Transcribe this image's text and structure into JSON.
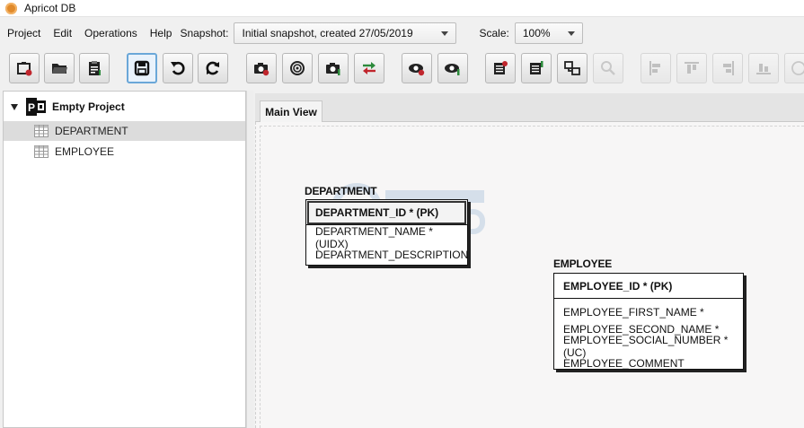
{
  "window": {
    "title": "Apricot DB"
  },
  "menu": {
    "items": [
      "Project",
      "Edit",
      "Operations",
      "Help"
    ],
    "snapshot_label": "Snapshot:",
    "snapshot_value": "Initial snapshot, created 27/05/2019",
    "scale_label": "Scale:",
    "scale_value": "100%"
  },
  "toolbar": {
    "buttons": [
      {
        "icon": "new-project-icon",
        "state": "normal"
      },
      {
        "icon": "open-folder-icon",
        "state": "normal"
      },
      {
        "icon": "clipboard-icon",
        "state": "normal"
      },
      {
        "icon": "save-icon",
        "state": "active"
      },
      {
        "icon": "undo-icon",
        "state": "normal"
      },
      {
        "icon": "redo-icon",
        "state": "normal"
      },
      {
        "icon": "snapshot-new-icon",
        "state": "normal"
      },
      {
        "icon": "snapshot-view-icon",
        "state": "normal"
      },
      {
        "icon": "snapshot-edit-icon",
        "state": "normal"
      },
      {
        "icon": "compare-icon",
        "state": "normal"
      },
      {
        "icon": "view-add-icon",
        "state": "normal"
      },
      {
        "icon": "view-edit-icon",
        "state": "normal"
      },
      {
        "icon": "table-add-icon",
        "state": "normal"
      },
      {
        "icon": "table-edit-icon",
        "state": "normal"
      },
      {
        "icon": "relationship-icon",
        "state": "normal"
      },
      {
        "icon": "search-icon",
        "state": "disabled"
      },
      {
        "icon": "align-left-icon",
        "state": "disabled"
      },
      {
        "icon": "align-top-icon",
        "state": "disabled"
      },
      {
        "icon": "align-right-icon",
        "state": "disabled"
      },
      {
        "icon": "align-bottom-icon",
        "state": "disabled"
      },
      {
        "icon": "more-icon",
        "state": "disabled"
      }
    ]
  },
  "sidebar": {
    "project_name": "Empty Project",
    "tables": [
      {
        "name": "DEPARTMENT",
        "selected": true
      },
      {
        "name": "EMPLOYEE",
        "selected": false
      }
    ]
  },
  "main": {
    "tab_label": "Main View",
    "entities": [
      {
        "name": "DEPARTMENT",
        "pk": "DEPARTMENT_ID * (PK)",
        "columns": [
          "DEPARTMENT_NAME * (UIDX)",
          "DEPARTMENT_DESCRIPTION"
        ]
      },
      {
        "name": "EMPLOYEE",
        "pk": "EMPLOYEE_ID * (PK)",
        "columns": [
          "EMPLOYEE_FIRST_NAME *",
          "EMPLOYEE_SECOND_NAME *",
          "EMPLOYEE_SOCIAL_NUMBER * (UC)",
          "EMPLOYEE_COMMENT"
        ]
      }
    ]
  }
}
